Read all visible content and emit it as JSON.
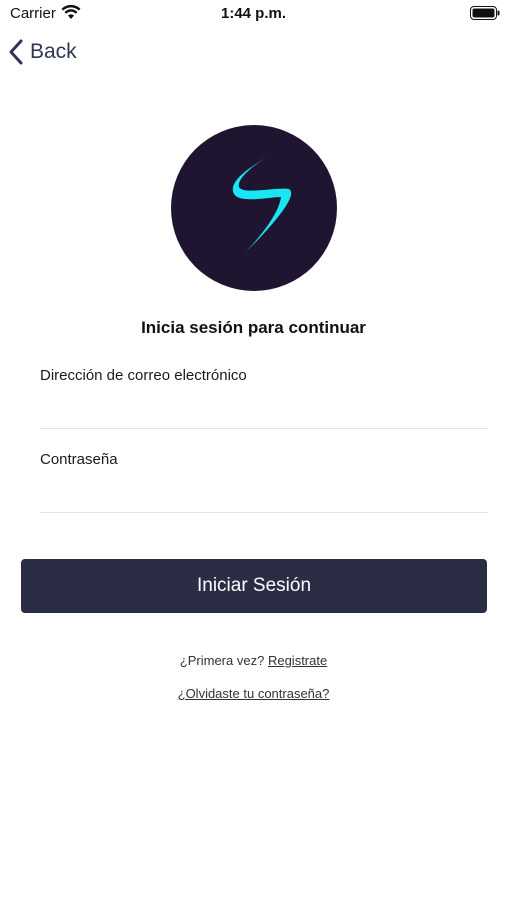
{
  "status_bar": {
    "carrier": "Carrier",
    "time": "1:44 p.m.",
    "wifi_icon": "wifi-icon",
    "battery_icon": "battery-full-icon"
  },
  "nav": {
    "back_label": "Back",
    "back_icon": "chevron-left-icon"
  },
  "logo": {
    "icon": "brand-s-logo",
    "background_color": "#1f1530",
    "accent_color": "#19e6f2"
  },
  "login": {
    "title": "Inicia sesión para continuar",
    "email_label": "Dirección de correo electrónico",
    "email_value": "",
    "password_label": "Contraseña",
    "password_value": "",
    "submit_label": "Iniciar Sesión",
    "submit_color": "#2b2d45"
  },
  "footer": {
    "first_time_text": "¿Primera vez?",
    "register_link": "Registrate",
    "forgot_link": "¿Olvidaste tu contraseña?"
  }
}
